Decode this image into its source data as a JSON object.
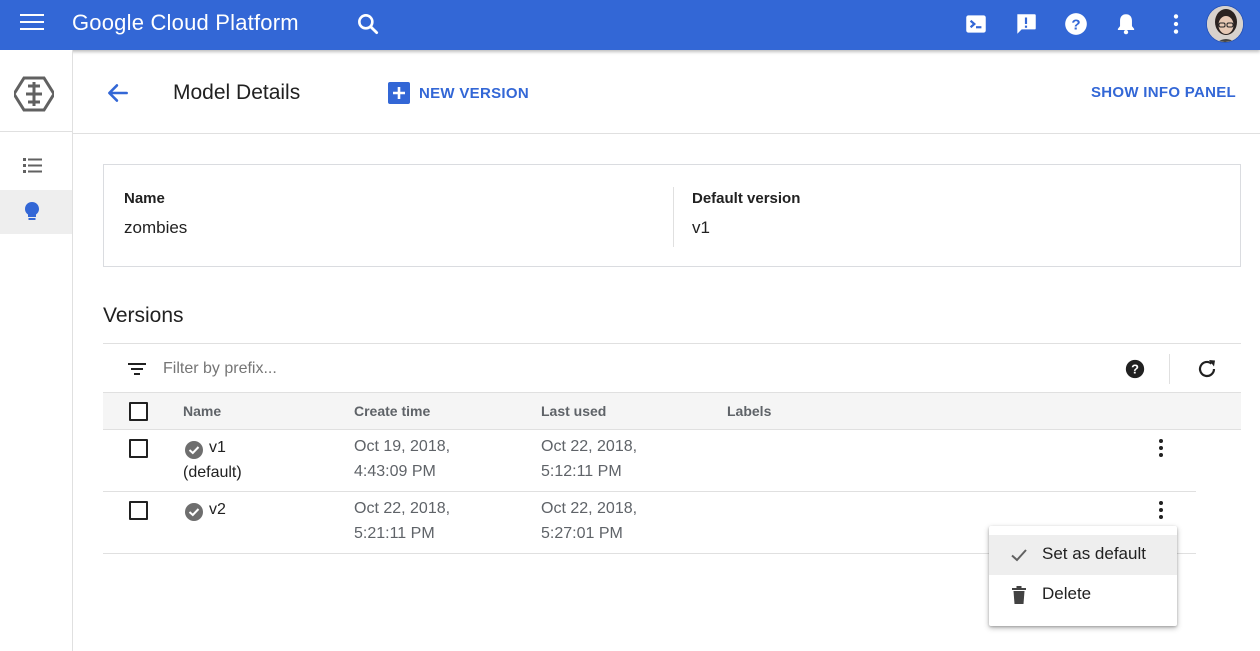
{
  "topbar": {
    "brand": "Google Cloud Platform",
    "icons": [
      "menu-icon",
      "search-icon",
      "cloud-shell-icon",
      "feedback-icon",
      "help-icon",
      "notifications-icon",
      "more-vert-icon",
      "avatar"
    ],
    "color": "#3367d6"
  },
  "rail": {
    "items": [
      "ml-engine-logo-icon",
      "list-icon",
      "lightbulb-icon"
    ],
    "active_item": "lightbulb-icon"
  },
  "header": {
    "title": "Model Details",
    "new_version_label": "NEW VERSION",
    "info_panel_label": "SHOW INFO PANEL",
    "accent": "#3367d6"
  },
  "details": {
    "name_label": "Name",
    "name_value": "zombies",
    "default_version_label": "Default version",
    "default_version_value": "v1"
  },
  "versions": {
    "title": "Versions",
    "filter_placeholder": "Filter by prefix...",
    "columns": [
      "Name",
      "Create time",
      "Last used",
      "Labels"
    ],
    "rows": [
      {
        "name": "v1",
        "name_suffix": "(default)",
        "status": "ok",
        "create_time_line1": "Oct 19, 2018,",
        "create_time_line2": "4:43:09 PM",
        "last_used_line1": "Oct 22, 2018,",
        "last_used_line2": "5:12:11 PM",
        "labels": ""
      },
      {
        "name": "v2",
        "name_suffix": "",
        "status": "ok",
        "create_time_line1": "Oct 22, 2018,",
        "create_time_line2": "5:21:11 PM",
        "last_used_line1": "Oct 22, 2018,",
        "last_used_line2": "5:27:01 PM",
        "labels": ""
      }
    ]
  },
  "context_menu": {
    "items": [
      {
        "label": "Set as default",
        "icon": "check-icon",
        "highlighted": true
      },
      {
        "label": "Delete",
        "icon": "trash-icon",
        "highlighted": false
      }
    ]
  }
}
